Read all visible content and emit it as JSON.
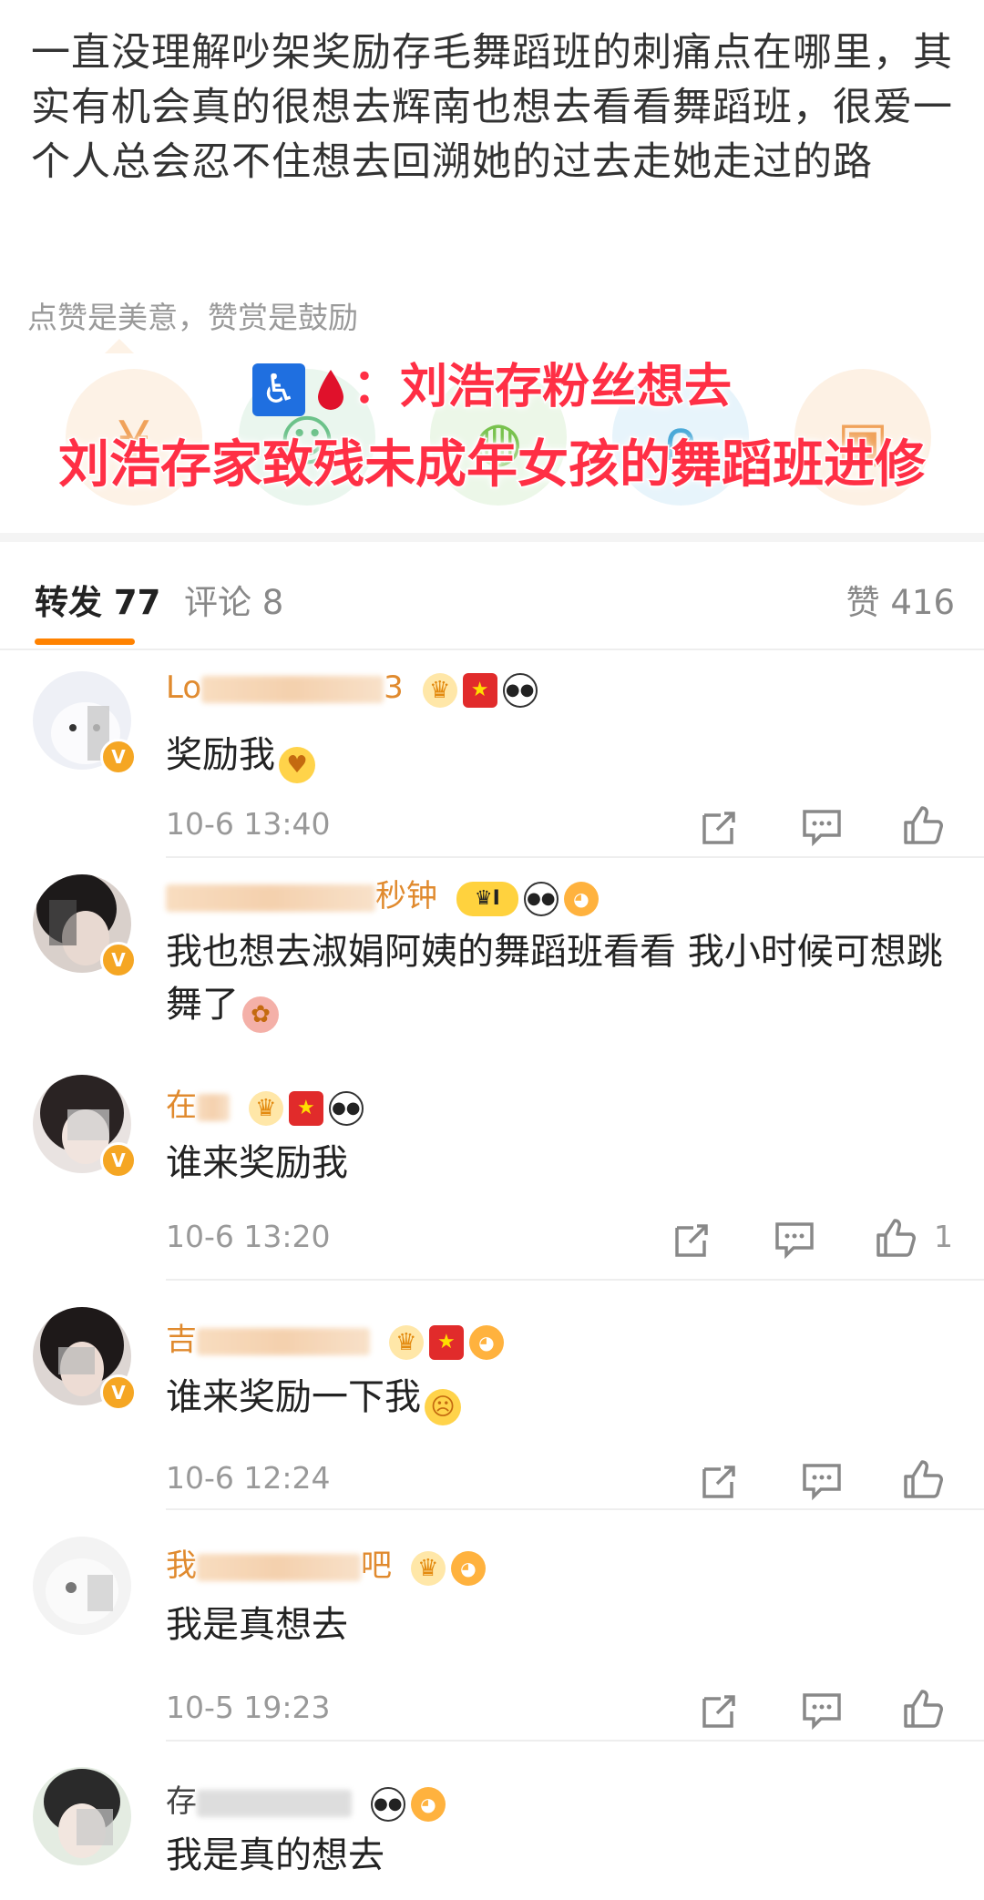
{
  "post": {
    "text": "一直没理解吵架奖励存毛舞蹈班的刺痛点在哪里，其实有机会真的很想去辉南也想去看看舞蹈班，很爱一个人总会忍不住想去回溯她的过去走她走过的路"
  },
  "reward": {
    "hint": "点赞是美意，赞赏是鼓励",
    "icons": [
      "yen-icon",
      "smile-icon",
      "ball-icon",
      "bag-icon",
      "gift-icon"
    ]
  },
  "overlay": {
    "line1_emoji_1": "♿",
    "line1_text": "：刘浩存粉丝想去",
    "line2_text": "刘浩存家致残未成年女孩的舞蹈班进修",
    "color": "#ff2f45"
  },
  "tabs": {
    "repost": "转发 77",
    "comment": "评论 8",
    "like": "赞 416",
    "accent": "#ff8200"
  },
  "comments": [
    {
      "username_visible": "Lo",
      "username_tail": "3",
      "badges": [
        "crown",
        "flag",
        "panda"
      ],
      "content": "奖励我",
      "time": "10-6 13:40",
      "likes": ""
    },
    {
      "username_visible": "",
      "username_tail": "秒钟",
      "badges": [
        "vip",
        "panda",
        "fish"
      ],
      "vip_label": "I",
      "content": "我也想去淑娟阿姨的舞蹈班看看 我小时候可想跳舞了",
      "time": "",
      "likes": ""
    },
    {
      "username_visible": "在",
      "username_tail": "",
      "badges": [
        "crown",
        "flag",
        "panda"
      ],
      "content": "谁来奖励我",
      "time": "10-6 13:20",
      "likes": "1"
    },
    {
      "username_visible": "吉",
      "username_tail": "",
      "badges": [
        "crown",
        "flag",
        "fish"
      ],
      "content": "谁来奖励一下我",
      "time": "10-6 12:24",
      "likes": ""
    },
    {
      "username_visible": "我",
      "username_tail": "吧",
      "badges": [
        "crown",
        "fish"
      ],
      "content": "我是真想去",
      "time": "10-5 19:23",
      "likes": ""
    },
    {
      "username_visible": "存",
      "username_tail": "",
      "badges": [
        "panda",
        "fish"
      ],
      "content": "我是真的想去",
      "time": "",
      "likes": ""
    }
  ]
}
